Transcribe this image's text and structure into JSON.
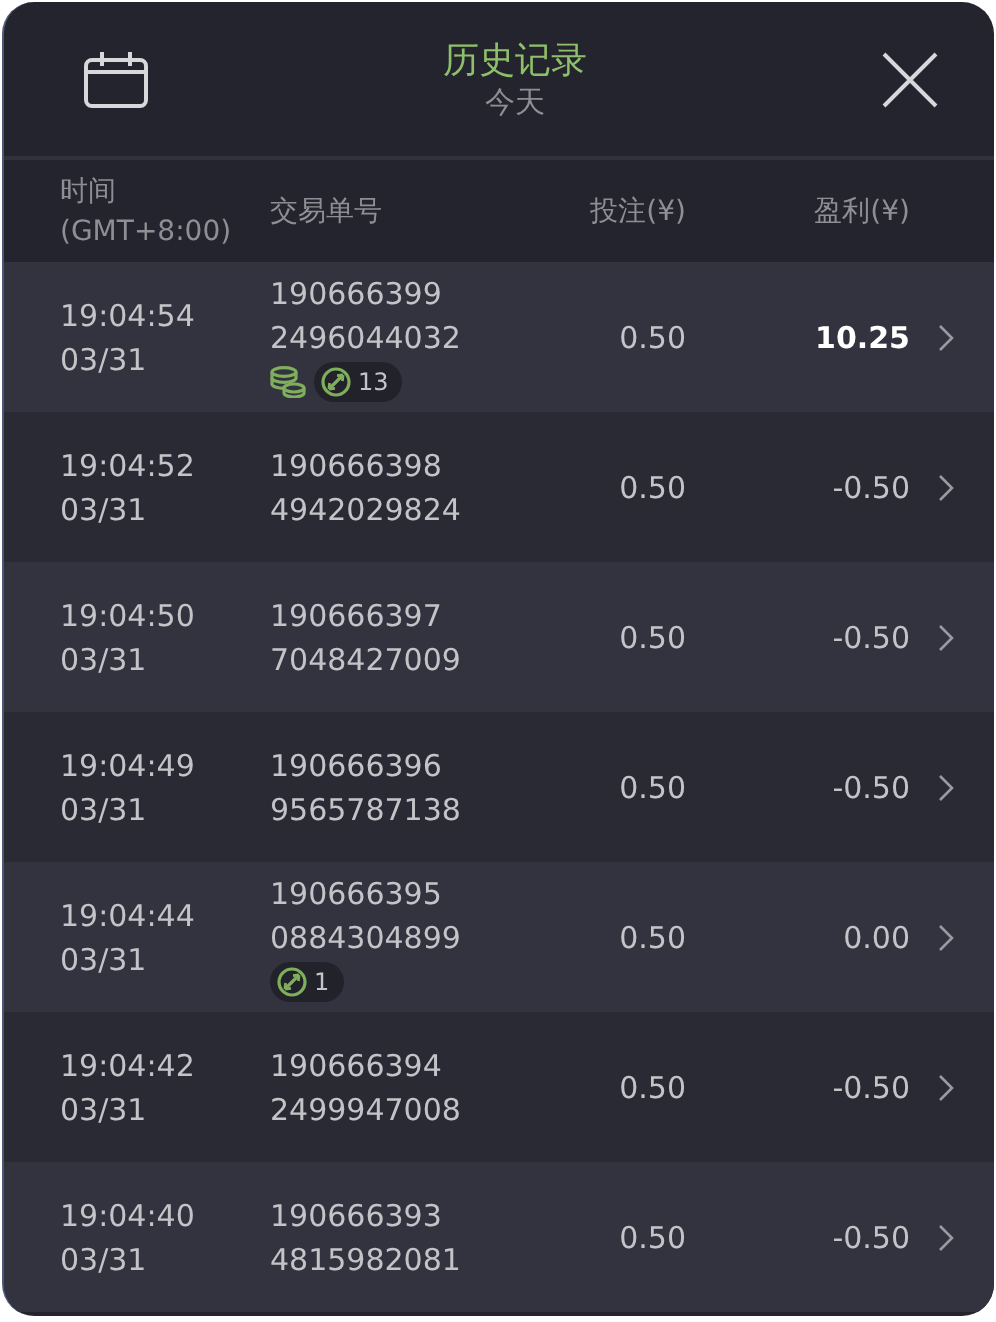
{
  "header": {
    "title": "历史记录",
    "subtitle": "今天"
  },
  "columns": [
    {
      "label": "时间",
      "sublabel": "(GMT+8:00)"
    },
    {
      "label": "交易单号"
    },
    {
      "label": "投注(¥)"
    },
    {
      "label": "盈利(¥)"
    }
  ],
  "rows": [
    {
      "time": "19:04:54",
      "date": "03/31",
      "order": [
        "190666399",
        "2496044032"
      ],
      "stake": "0.50",
      "profit": "10.25",
      "won": true,
      "coins": true,
      "spins": "13"
    },
    {
      "time": "19:04:52",
      "date": "03/31",
      "order": [
        "190666398",
        "4942029824"
      ],
      "stake": "0.50",
      "profit": "-0.50",
      "won": false,
      "coins": false
    },
    {
      "time": "19:04:50",
      "date": "03/31",
      "order": [
        "190666397",
        "7048427009"
      ],
      "stake": "0.50",
      "profit": "-0.50",
      "won": false,
      "coins": false
    },
    {
      "time": "19:04:49",
      "date": "03/31",
      "order": [
        "190666396",
        "9565787138"
      ],
      "stake": "0.50",
      "profit": "-0.50",
      "won": false,
      "coins": false
    },
    {
      "time": "19:04:44",
      "date": "03/31",
      "order": [
        "190666395",
        "0884304899"
      ],
      "stake": "0.50",
      "profit": "0.00",
      "won": false,
      "coins": false,
      "spins": "1"
    },
    {
      "time": "19:04:42",
      "date": "03/31",
      "order": [
        "190666394",
        "2499947008"
      ],
      "stake": "0.50",
      "profit": "-0.50",
      "won": false,
      "coins": false
    },
    {
      "time": "19:04:40",
      "date": "03/31",
      "order": [
        "190666393",
        "4815982081"
      ],
      "stake": "0.50",
      "profit": "-0.50",
      "won": false,
      "coins": false
    }
  ]
}
